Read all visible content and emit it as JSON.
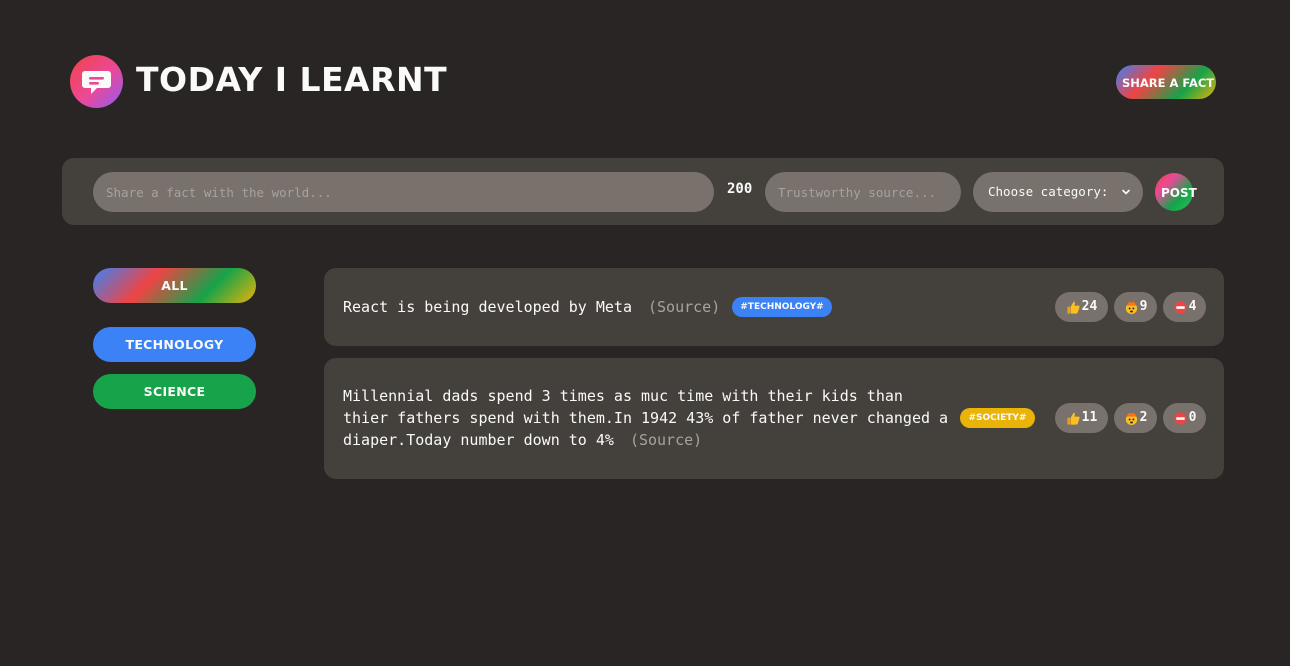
{
  "header": {
    "title": "TODAY I LEARNT",
    "share_button": "SHARE A FACT",
    "logo_icon": "chat-bubble-icon"
  },
  "form": {
    "fact_placeholder": "Share a fact with the world...",
    "fact_value": "",
    "char_count": "200",
    "source_placeholder": "Trustworthy source...",
    "source_value": "",
    "category_selected": "Choose category:",
    "post_button": "POST"
  },
  "sidebar": {
    "categories": [
      {
        "label": "ALL",
        "color": "gradient"
      },
      {
        "label": "TECHNOLOGY",
        "color": "#3b82f6"
      },
      {
        "label": "SCIENCE",
        "color": "#16a34a"
      }
    ]
  },
  "facts": [
    {
      "text": "React is being developed by Meta",
      "source": "(Source)",
      "tag": "#TECHNOLOGY#",
      "tag_color": "#3b82f6",
      "votes": {
        "interesting": "24",
        "mindblowing": "9",
        "false": "4"
      }
    },
    {
      "text": "Millennial dads spend 3 times as muc time with their kids than thier fathers spend with them.In 1942 43% of father never changed a diaper.Today number down to 4%",
      "source": "(Source)",
      "tag": "#SOCIETY#",
      "tag_color": "#eab308",
      "votes": {
        "interesting": "11",
        "mindblowing": "2",
        "false": "0"
      }
    }
  ],
  "vote_icons": [
    "thumbs-up-icon",
    "mind-blown-icon",
    "no-entry-icon"
  ],
  "colors": {
    "background": "#292524",
    "panel": "#44403c",
    "input": "#78716c",
    "text": "#fafaf9",
    "muted": "#a8a29e"
  }
}
